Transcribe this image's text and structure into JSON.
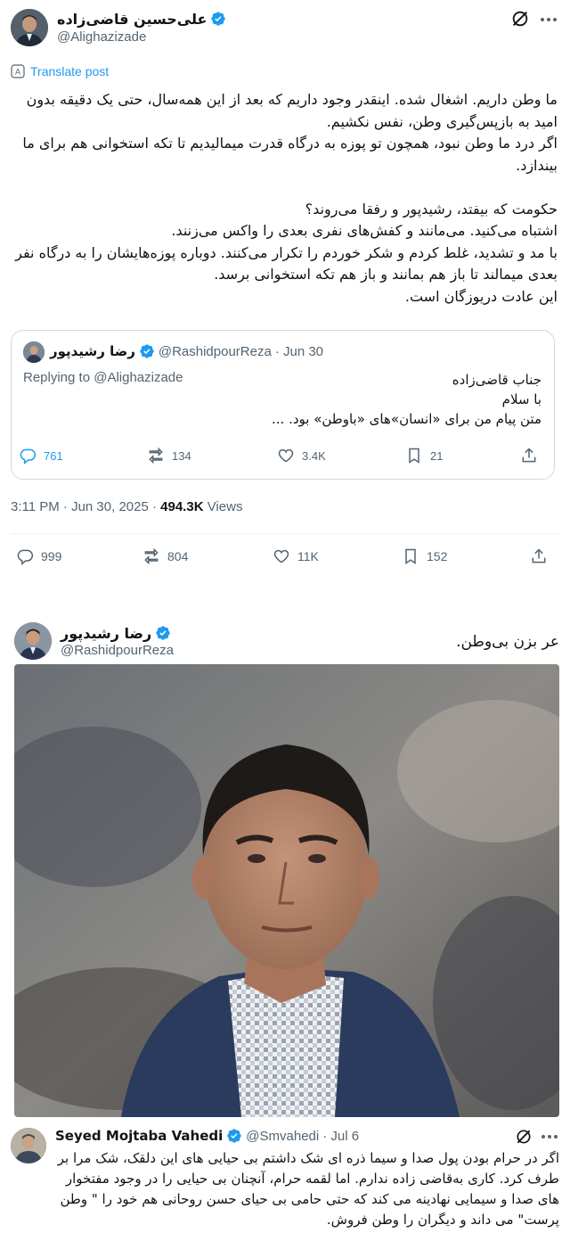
{
  "colors": {
    "accent": "#1d9bf0",
    "muted": "#536471",
    "text": "#0f1419",
    "verified": "#1d9bf0"
  },
  "tweet1": {
    "author_name": "علی‌حسین قاضی‌زاده",
    "author_handle": "@Alighazizade",
    "translate_label": "Translate post",
    "text": "ما وطن داریم. اشغال شده. اینقدر وجود داریم که بعد از این همه‌سال، حتی یک دقیقه بدون امید به بازپس‌گیری وطن، نفس نکشیم.\nاگر درد ما وطن نبود، همچون تو پوزه به درگاه قدرت میمالیدیم تا تکه استخوانی هم برای ما بیندازد.\n\nحکومت که بیفتد، رشیدپور و رفقا می‌روند؟\nاشتباه می‌کنید. می‌مانند و کفش‌های نفری بعدی را واکس می‌زنند.\nبا مد و تشدید، غلط کردم و شکر خوردم را تکرار می‌کنند. دوباره پوزه‌هایشان را به درگاه نفر بعدی میمالند تا باز هم بمانند و باز هم تکه استخوانی برسد.\nاین عادت دریوزگان است.",
    "quote": {
      "author_name": "رضا رشیدپور",
      "author_handle": "@RashidpourReza",
      "date": "· Jun 30",
      "replying_to": "Replying to @Alighazizade",
      "text": "جناب قاضی‌زاده\nبا سلام\nمتن پیام من برای «انسان»های «باوطن» بود. ...",
      "replies": "761",
      "reposts": "134",
      "likes": "3.4K",
      "bookmarks": "21"
    },
    "time": "3:11 PM · Jun 30, 2025 · ",
    "views_count": "494.3K",
    "views_label": " Views",
    "replies": "999",
    "reposts": "804",
    "likes": "11K",
    "bookmarks": "152"
  },
  "tweet2": {
    "author_name": "رضا رشیدپور",
    "author_handle": "@RashidpourReza",
    "text": "عر بزن بی‌وطن."
  },
  "tweet3": {
    "author_name": "Seyed Mojtaba Vahedi",
    "author_handle": "@Smvahedi",
    "date": "· Jul 6",
    "text": "اگر در حرام بودن پول صدا و سیما ذره ای شک داشتم بی حیایی های این دلقک، شک مرا بر طرف کرد. کاری به‌قاضی زاده ندارم. اما لقمه حرام، آنچنان بی حیایی را در وجود مفتخوار های صدا و سیمایی نهادینه می کند که حتی حامی بی حیای حسن روحانی هم خود را \" وطن پرست\" می داند و دیگران را وطن فروش."
  }
}
